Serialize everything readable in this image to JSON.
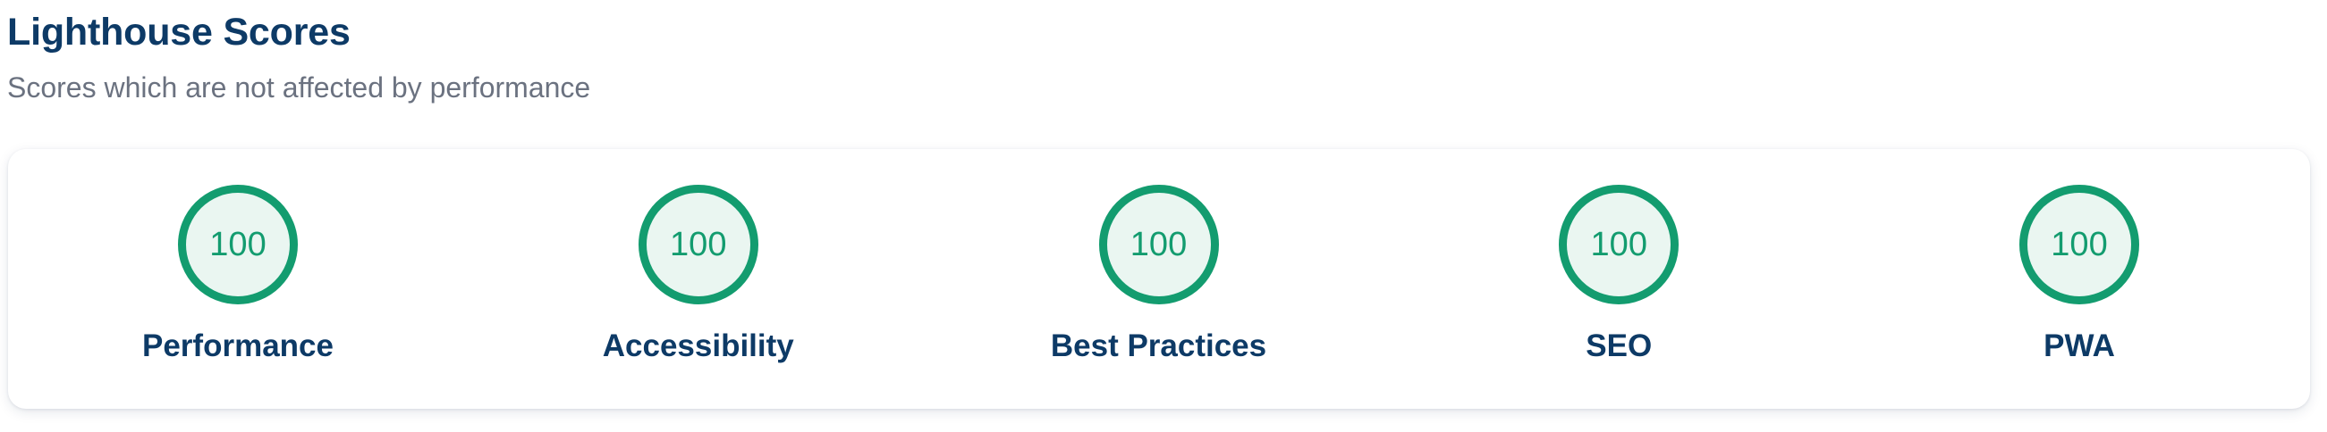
{
  "header": {
    "title": "Lighthouse Scores",
    "subtitle": "Scores which are not affected by performance"
  },
  "colors": {
    "title": "#0d3a66",
    "subtitle": "#6b7280",
    "score_good": "#139c6f",
    "gauge_fill": "#eaf6f1"
  },
  "scores": [
    {
      "label": "Performance",
      "value": "100"
    },
    {
      "label": "Accessibility",
      "value": "100"
    },
    {
      "label": "Best Practices",
      "value": "100"
    },
    {
      "label": "SEO",
      "value": "100"
    },
    {
      "label": "PWA",
      "value": "100"
    }
  ]
}
